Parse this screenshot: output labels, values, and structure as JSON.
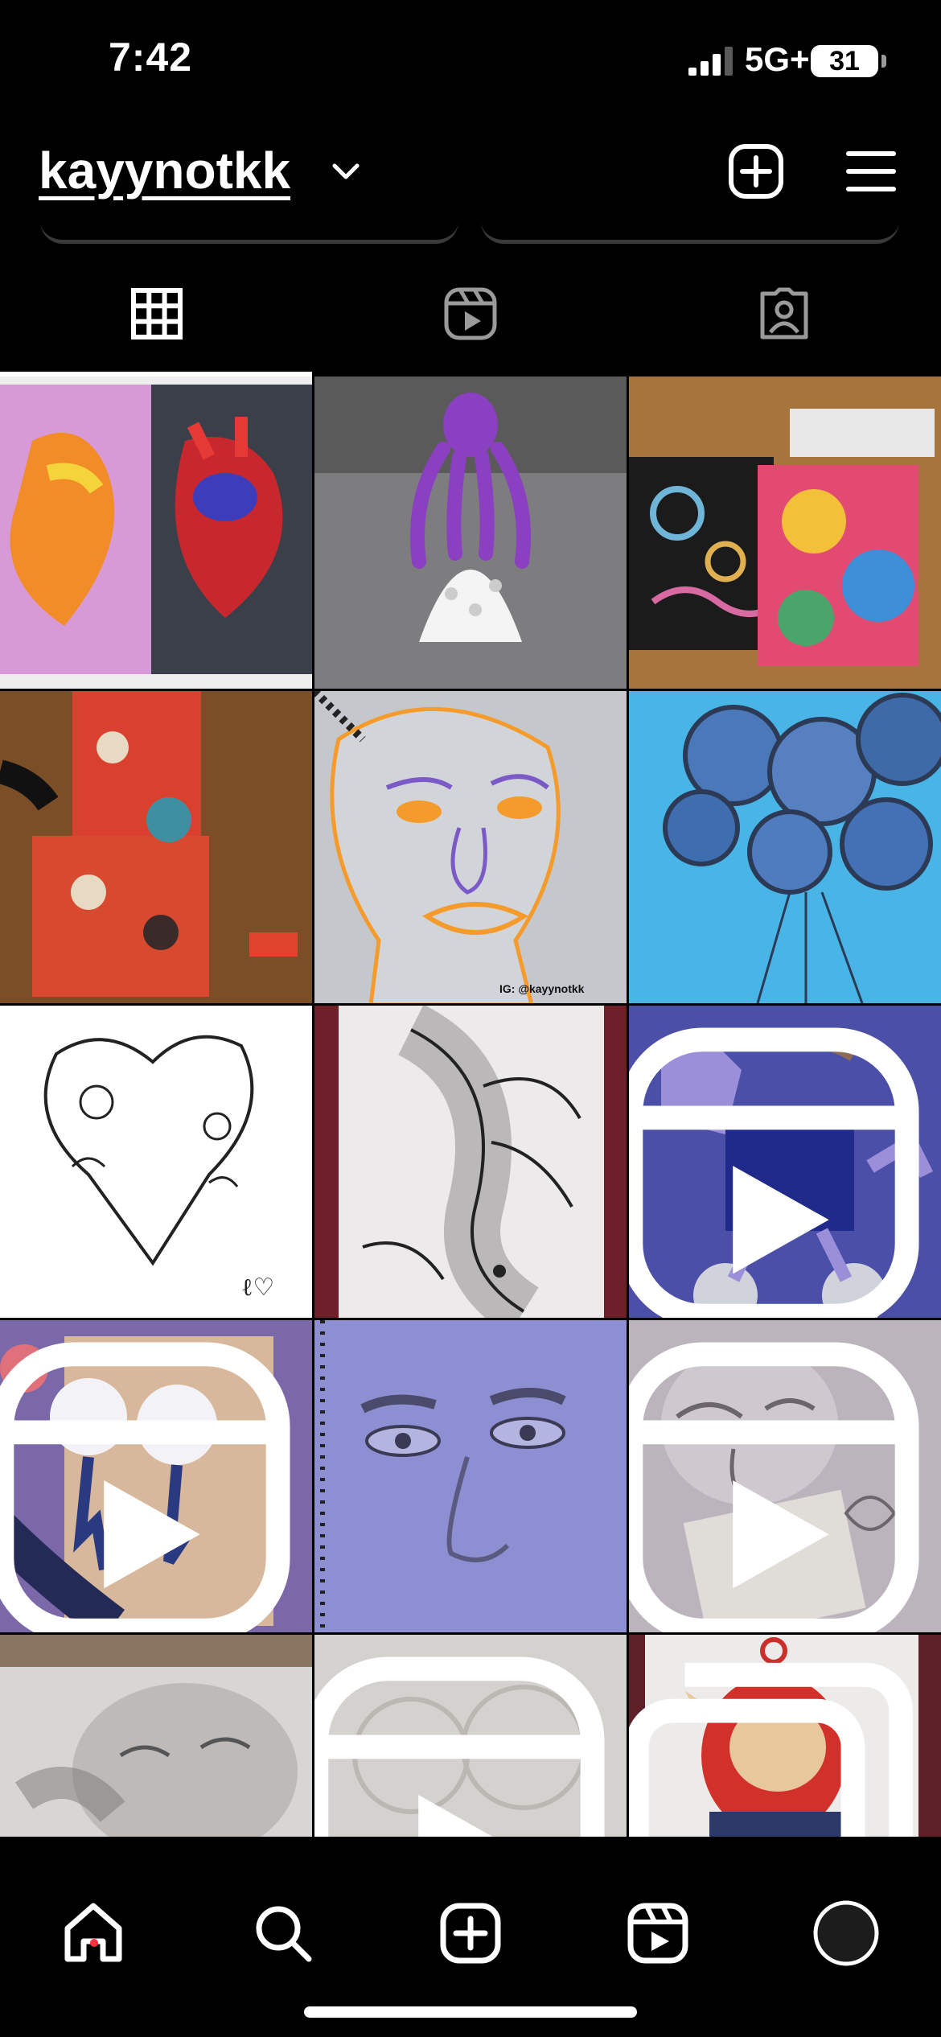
{
  "status_bar": {
    "time": "7:42",
    "network": "5G+",
    "battery": "31"
  },
  "header": {
    "username": "kayynotkk",
    "icons": [
      "chevron-down-icon",
      "create-plus-icon",
      "hamburger-menu-icon"
    ]
  },
  "tabs": [
    {
      "name": "posts-grid",
      "icon": "grid-icon",
      "selected": true
    },
    {
      "name": "reels",
      "icon": "reels-icon",
      "selected": false
    },
    {
      "name": "tagged",
      "icon": "tagged-person-icon",
      "selected": false
    }
  ],
  "posts": [
    {
      "subject": "two painted anatomical hearts in sketchbook",
      "reel": false
    },
    {
      "subject": "3D printed purple octopus on white lattice base",
      "reel": false
    },
    {
      "subject": "colorful abstract paintings on table",
      "reel": false
    },
    {
      "subject": "red patterned cartoon artworks on wood floor",
      "reel": false
    },
    {
      "subject": "digital portrait sketch with orange lines",
      "reel": false,
      "watermark": "IG: @kayynotkk"
    },
    {
      "subject": "blue balloons drawing",
      "reel": false
    },
    {
      "subject": "line art heart wreath of flowers",
      "reel": false
    },
    {
      "subject": "koi fish zentangle drawing",
      "reel": false
    },
    {
      "subject": "purple painted character",
      "reel": true
    },
    {
      "subject": "painted eyes artwork",
      "reel": true
    },
    {
      "subject": "pencil face drawing",
      "reel": true
    },
    {
      "subject": "pencil drawing of face",
      "reel": true
    },
    {
      "subject": "pencil drawing of sleeping baby",
      "reel": false
    },
    {
      "subject": "faint pencil sketch",
      "reel": true
    },
    {
      "subject": "red teletubby character drawing",
      "reel": false,
      "carousel": true
    }
  ],
  "colors": {
    "background": "#000000",
    "accent_dot": "#ff3040"
  },
  "bottom_nav": [
    {
      "name": "home",
      "icon": "home-icon",
      "active": true
    },
    {
      "name": "search",
      "icon": "search-icon"
    },
    {
      "name": "create",
      "icon": "create-plus-icon"
    },
    {
      "name": "reels",
      "icon": "reels-icon"
    },
    {
      "name": "profile",
      "icon": "profile-avatar-icon"
    }
  ]
}
